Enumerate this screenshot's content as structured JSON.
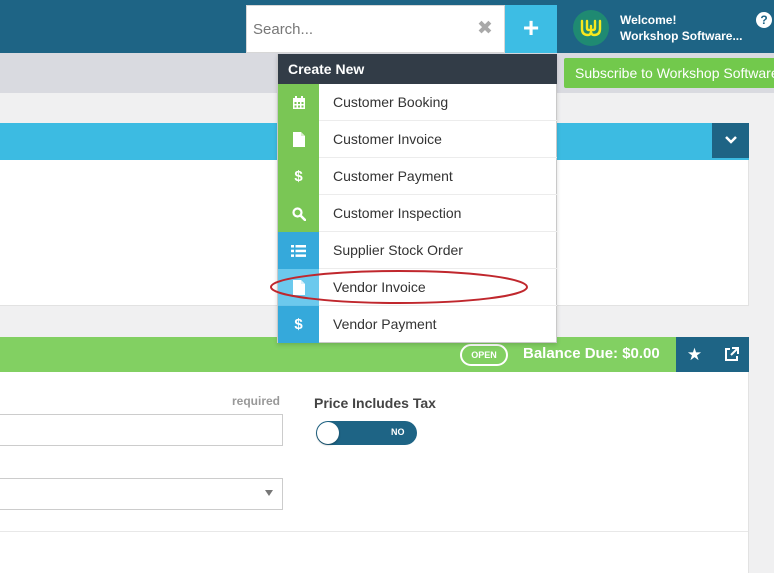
{
  "header": {
    "search_placeholder": "Search...",
    "clear_icon": "close-icon",
    "add_label": "+",
    "welcome": "Welcome!",
    "company": "Workshop Software...",
    "help_label": "?"
  },
  "subbar": {
    "subscribe_label": "Subscribe to Workshop Software"
  },
  "create_menu": {
    "title": "Create New",
    "items": [
      {
        "label": "Customer Booking",
        "icon": "calendar-icon",
        "color": "#7ac655"
      },
      {
        "label": "Customer Invoice",
        "icon": "document-icon",
        "color": "#7ac655"
      },
      {
        "label": "Customer Payment",
        "icon": "dollar-icon",
        "color": "#7ac655"
      },
      {
        "label": "Customer Inspection",
        "icon": "search-icon",
        "color": "#7ac655"
      },
      {
        "label": "Supplier Stock Order",
        "icon": "list-icon",
        "color": "#35a9db"
      },
      {
        "label": "Vendor Invoice",
        "icon": "document-icon",
        "color": "#35a9db"
      },
      {
        "label": "Vendor Payment",
        "icon": "dollar-icon",
        "color": "#35a9db"
      }
    ]
  },
  "panel2": {
    "status_badge": "OPEN",
    "balance_due": "Balance Due: $0.00",
    "required_label": "required",
    "price_includes_tax_label": "Price Includes Tax",
    "toggle_value": "NO"
  },
  "colors": {
    "header": "#1e6485",
    "accent_blue": "#3cbbe2",
    "accent_green": "#82d062",
    "menu_title": "#323c47",
    "highlight": "#c0272d"
  }
}
